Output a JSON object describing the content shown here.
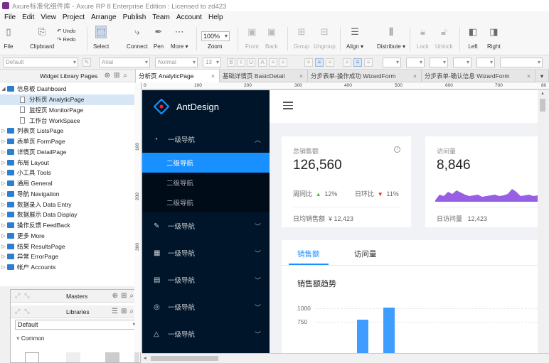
{
  "window": {
    "title": "Axure标准化组件库 - Axure RP 8 Enterprise Edition : Licensed to zd423"
  },
  "menu": [
    "File",
    "Edit",
    "View",
    "Project",
    "Arrange",
    "Publish",
    "Team",
    "Account",
    "Help"
  ],
  "toolbar": {
    "file": "File",
    "clipboard": "Clipboard",
    "undo": "Undo",
    "redo": "Redo",
    "select": "Select",
    "connect": "Connect",
    "pen": "Pen",
    "more": "More ▾",
    "zoom_value": "100%",
    "zoom": "Zoom",
    "front": "Front",
    "back": "Back",
    "group": "Group",
    "ungroup": "Ungroup",
    "align": "Align ▾",
    "distribute": "Distribute ▾",
    "lock": "Lock",
    "unlock": "Unlock",
    "left": "Left",
    "right": "Right"
  },
  "formatbar": {
    "style": "Default",
    "font": "Arial",
    "weight": "Normal",
    "size": "13"
  },
  "left_pane": {
    "title": "Widget Library Pages",
    "pages": [
      {
        "label": "信息板 Dashboard",
        "type": "folder",
        "expanded": true
      },
      {
        "label": "分析页 AnalyticPage",
        "type": "page",
        "selected": true
      },
      {
        "label": "监控页 MonitorPage",
        "type": "page"
      },
      {
        "label": "工作台 WorkSpace",
        "type": "page"
      },
      {
        "label": "列表页 ListsPage",
        "type": "folder"
      },
      {
        "label": "表单页 FormPage",
        "type": "folder"
      },
      {
        "label": "详情页 DetailPage",
        "type": "folder"
      },
      {
        "label": "布局 Layout",
        "type": "folder"
      },
      {
        "label": "小工具 Tools",
        "type": "folder"
      },
      {
        "label": "通用 General",
        "type": "folder"
      },
      {
        "label": "导航 Navigation",
        "type": "folder"
      },
      {
        "label": "数据录入 Data Entry",
        "type": "folder"
      },
      {
        "label": "数据展示 Data Display",
        "type": "folder"
      },
      {
        "label": "操作反馈 FeedBack",
        "type": "folder"
      },
      {
        "label": "更多 More",
        "type": "folder"
      },
      {
        "label": "结果 ResultsPage",
        "type": "folder"
      },
      {
        "label": "异常 ErrorPage",
        "type": "folder"
      },
      {
        "label": "帐户 Accounts",
        "type": "folder"
      }
    ]
  },
  "masters": {
    "title": "Masters"
  },
  "libraries": {
    "title": "Libraries",
    "selected": "Default",
    "group": "Common"
  },
  "tabs": [
    {
      "label": "分析页 AnalyticPage",
      "active": true
    },
    {
      "label": "基础详情页 BasicDetail"
    },
    {
      "label": "分步表单-操作成功 WizardForm"
    },
    {
      "label": "分步表单-确认信息 WizardForm"
    }
  ],
  "ruler": {
    "h": [
      "0",
      "100",
      "200",
      "300",
      "400",
      "500",
      "600",
      "700",
      "80"
    ],
    "v": [
      "100",
      "200",
      "300"
    ]
  },
  "canvas": {
    "brand": "AntDesign",
    "nav": {
      "group": "一级导航",
      "sub": [
        "二级导航",
        "二级导航",
        "二级导航"
      ]
    },
    "sales_card": {
      "label": "总销售额",
      "value": "126,560",
      "wow_label": "周同比",
      "wow_value": "12%",
      "dod_label": "日环比",
      "dod_value": "11%",
      "daily_label": "日均销售额",
      "daily_value": "¥ 12,423"
    },
    "visits_card": {
      "label": "访问量",
      "value": "8,846",
      "daily_label": "日访问量",
      "daily_value": "12,423"
    },
    "chart_tabs": [
      "销售额",
      "访问量"
    ],
    "chart_title": "销售额趋势"
  },
  "chart_data": {
    "type": "bar",
    "title": "销售额趋势",
    "y_ticks": [
      "1000",
      "750"
    ],
    "values": [
      0,
      790,
      1010,
      30
    ],
    "ylim": [
      0,
      1000
    ]
  },
  "colors": {
    "primary": "#1890ff",
    "sider": "#001529",
    "area": "#975fe4",
    "bar": "#3f9dff"
  }
}
